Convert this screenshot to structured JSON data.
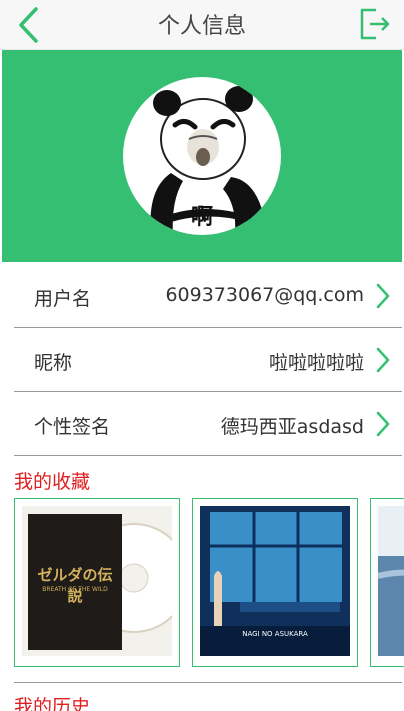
{
  "header": {
    "title": "个人信息"
  },
  "profile": {
    "avatar_caption": "啊"
  },
  "rows": [
    {
      "label": "用户名",
      "value": "609373067@qq.com"
    },
    {
      "label": "昵称",
      "value": "啦啦啦啦啦"
    },
    {
      "label": "个性签名",
      "value": "德玛西亚asdasd"
    }
  ],
  "favorites": {
    "title": "我的收藏",
    "items": [
      {
        "cover_title": "ゼルダの伝説",
        "cover_subtitle": "BREATH OF THE WILD"
      },
      {
        "cover_title": "NAGI NO ASUKARA"
      },
      {
        "cover_title": ""
      }
    ]
  },
  "history": {
    "title": "我的历史"
  },
  "colors": {
    "accent": "#34bf73",
    "section_title": "#e02020"
  }
}
